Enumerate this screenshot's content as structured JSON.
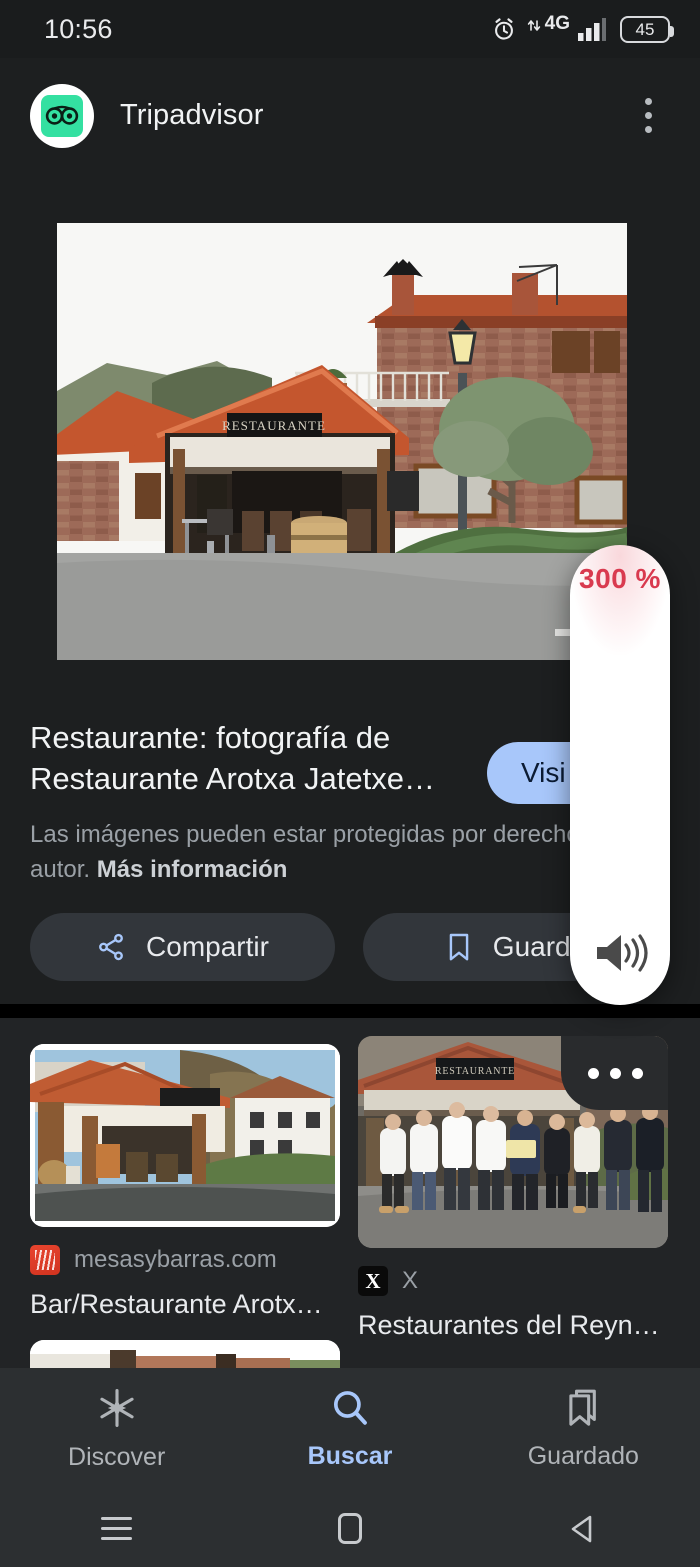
{
  "statusbar": {
    "time": "10:56",
    "alarm_icon": "alarm-clock-icon",
    "network_label": "4G",
    "signal_icon": "signal-bars-icon",
    "battery_level": "45"
  },
  "header": {
    "app_name": "Tripadvisor",
    "favicon_icon": "tripadvisor-owl-icon",
    "overflow_icon": "kebab-menu-icon"
  },
  "card": {
    "title": "Restaurante: fotografía de Restaurante Arotxa Jatetxe…",
    "visit_label": "Visi",
    "copyright_text": "Las imágenes pueden estar protegidas por derechos",
    "copyright_text2": "autor. ",
    "copyright_link": "Más información",
    "share_label": "Compartir",
    "share_icon": "share-icon",
    "save_label": "Guarda",
    "save_icon": "bookmark-icon"
  },
  "results": [
    {
      "source": "mesasybarras.com",
      "favicon_icon": "mesasybarras-favicon",
      "title": "Bar/Restaurante Arotx…"
    },
    {
      "source": "X",
      "favicon_icon": "x-logo-favicon",
      "title": "Restaurantes del Reyn…"
    }
  ],
  "more_button": {
    "icon": "more-horizontal-icon"
  },
  "bottomnav": {
    "items": [
      {
        "label": "Discover",
        "icon": "discover-asterisk-icon",
        "active": false
      },
      {
        "label": "Buscar",
        "icon": "search-icon",
        "active": true
      },
      {
        "label": "Guardado",
        "icon": "bookmark-outline-icon",
        "active": false
      }
    ]
  },
  "sysnav": {
    "recents_icon": "recents-hamburger-icon",
    "home_icon": "home-square-icon",
    "back_icon": "back-triangle-icon"
  },
  "volume_overlay": {
    "percent": "300 %",
    "speaker_icon": "speaker-volume-icon"
  },
  "colors": {
    "accent_blue": "#a8c7fa",
    "volume_red": "#d93a4f",
    "tripadvisor_green": "#34e0a1",
    "background": "#1d1f20",
    "results_background": "#222426",
    "nav_background": "#2c2f31"
  }
}
